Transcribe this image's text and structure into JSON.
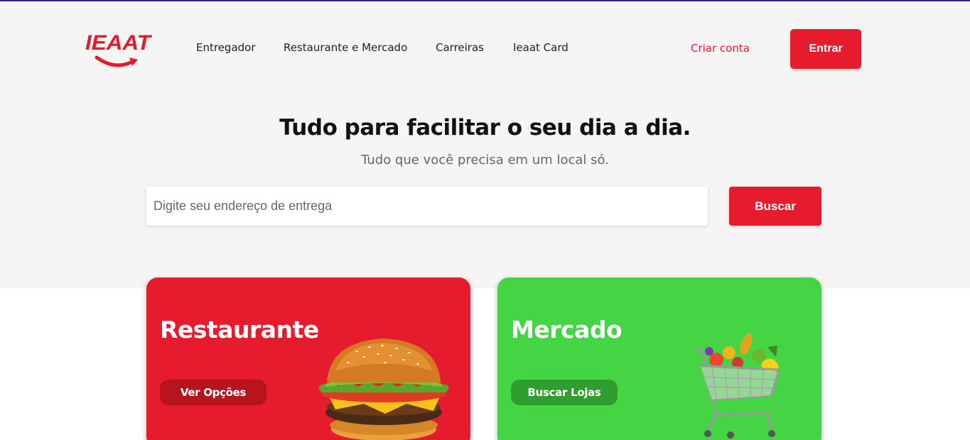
{
  "header": {
    "logo_text": "IEAAT",
    "nav": [
      "Entregador",
      "Restaurante e Mercado",
      "Carreiras",
      "Ieaat Card"
    ],
    "signup_label": "Criar conta",
    "login_label": "Entrar"
  },
  "hero": {
    "title": "Tudo para facilitar o seu dia a dia.",
    "subtitle": "Tudo que você precisa em um local só."
  },
  "search": {
    "placeholder": "Digite seu endereço de entrega",
    "value": "",
    "button_label": "Buscar"
  },
  "cards": [
    {
      "title": "Restaurante",
      "button_label": "Ver Opções",
      "color": "#e61c2e",
      "image_icon": "burger-image"
    },
    {
      "title": "Mercado",
      "button_label": "Buscar Lojas",
      "color": "#44d444",
      "image_icon": "shopping-cart-image"
    }
  ],
  "colors": {
    "brand": "#e61c2e",
    "market": "#44d444",
    "hero_background": "#f5f5f5"
  }
}
